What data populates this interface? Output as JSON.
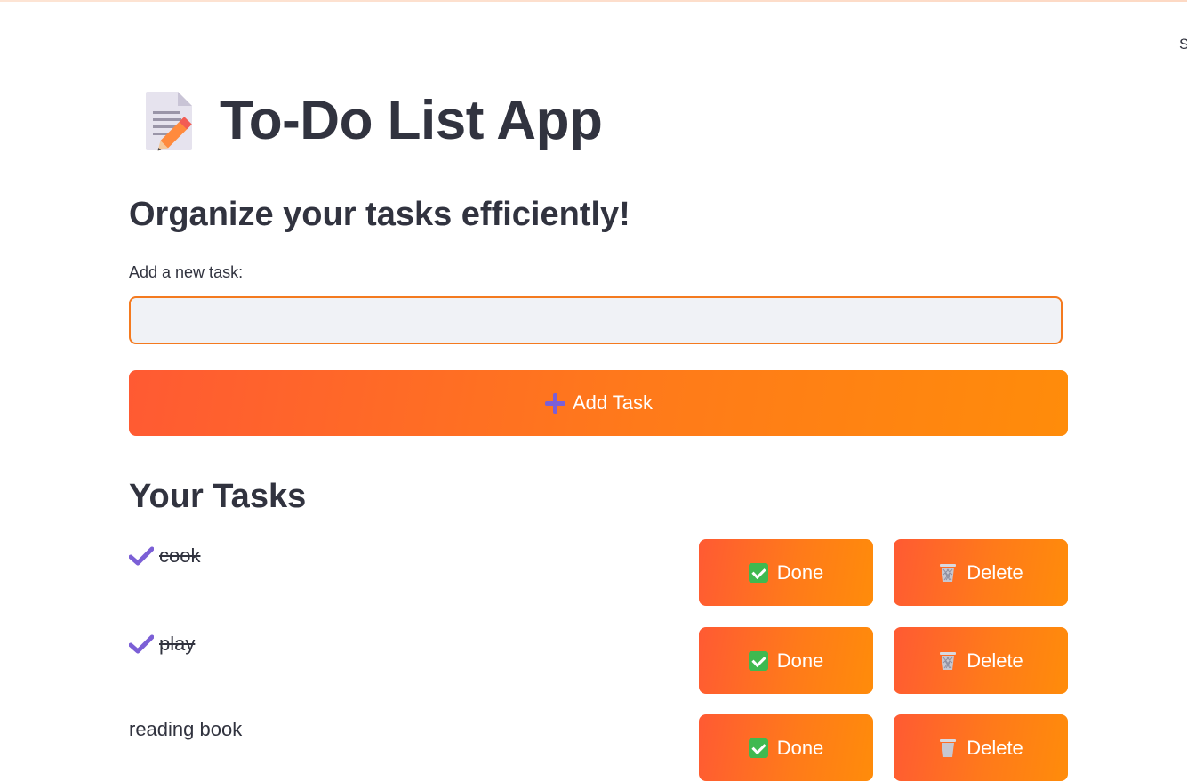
{
  "app": {
    "title": "To-Do List App",
    "subtitle": "Organize your tasks efficiently!",
    "corner_text": "S",
    "title_icon": "memo-icon"
  },
  "input": {
    "label": "Add a new task:",
    "value": "",
    "placeholder": ""
  },
  "add_button": {
    "label": "Add Task",
    "icon": "plus-icon"
  },
  "tasks_section": {
    "title": "Your Tasks"
  },
  "tasks": [
    {
      "text": "cook",
      "completed": true,
      "done_label": "Done",
      "delete_label": "Delete"
    },
    {
      "text": "play",
      "completed": true,
      "done_label": "Done",
      "delete_label": "Delete"
    },
    {
      "text": "reading book",
      "completed": false,
      "done_label": "Done",
      "delete_label": "Delete"
    }
  ],
  "colors": {
    "accent_start": "#ff5a33",
    "accent_end": "#ff8c0a",
    "input_border": "#f47a1f",
    "input_bg": "#f0f2f6",
    "text": "#31333f"
  }
}
